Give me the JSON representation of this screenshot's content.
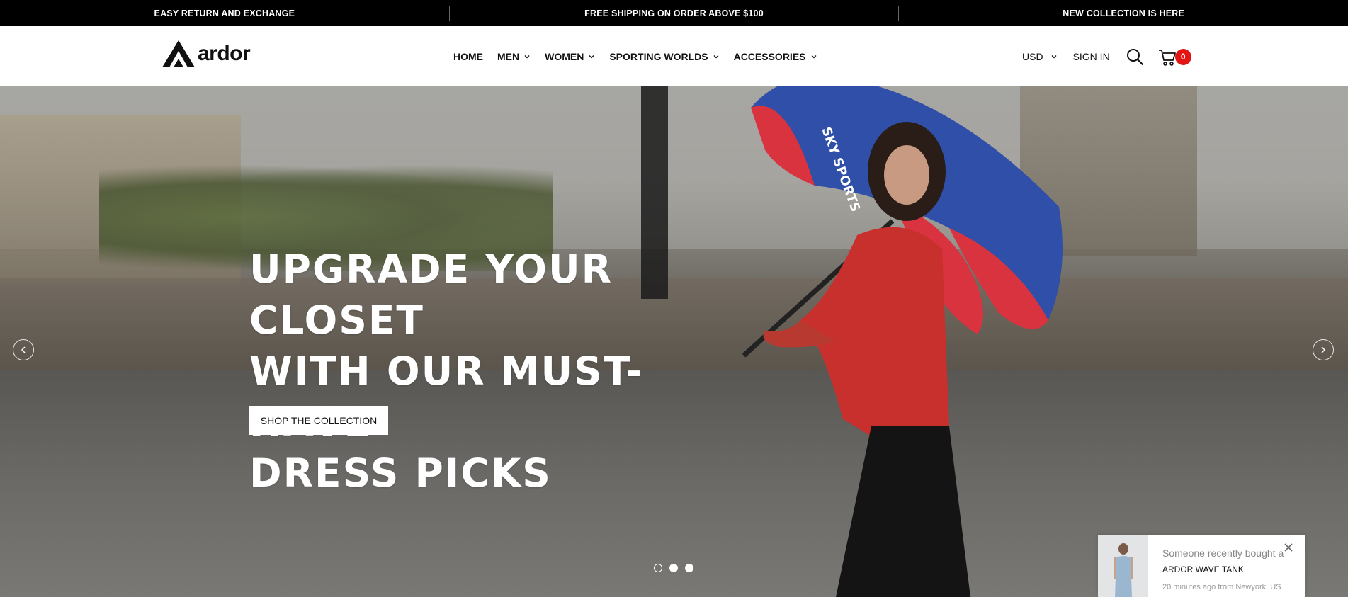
{
  "announcements": [
    "EASY RETURN AND EXCHANGE",
    "FREE SHIPPING ON ORDER ABOVE $100",
    "NEW COLLECTION IS HERE"
  ],
  "brand": {
    "name": "ardor"
  },
  "nav": {
    "items": [
      {
        "label": "HOME",
        "has_dropdown": false
      },
      {
        "label": "MEN",
        "has_dropdown": true
      },
      {
        "label": "WOMEN",
        "has_dropdown": true
      },
      {
        "label": "SPORTING WORLDS",
        "has_dropdown": true
      },
      {
        "label": "ACCESSORIES",
        "has_dropdown": true
      }
    ]
  },
  "header_tools": {
    "currency": "USD",
    "sign_in": "SIGN IN",
    "search_icon": "search-icon",
    "cart_icon": "cart-icon",
    "cart_count": "0"
  },
  "hero": {
    "headline": [
      "UPGRADE YOUR CLOSET",
      "WITH OUR MUST-HAVE",
      "DRESS PICKS"
    ],
    "cta_label": "SHOP THE COLLECTION",
    "prev_icon": "chevron-left-icon",
    "next_icon": "chevron-right-icon",
    "slides_total": 3,
    "active_slide": 1,
    "umbrella_print": "SKY SPORTS"
  },
  "recent_purchase": {
    "line1": "Someone recently bought a",
    "product": "ARDOR WAVE TANK",
    "meta": "20 minutes ago from Newyork, US"
  },
  "colors": {
    "topbar_bg": "#000000",
    "badge": "#e31414",
    "text": "#111111"
  }
}
